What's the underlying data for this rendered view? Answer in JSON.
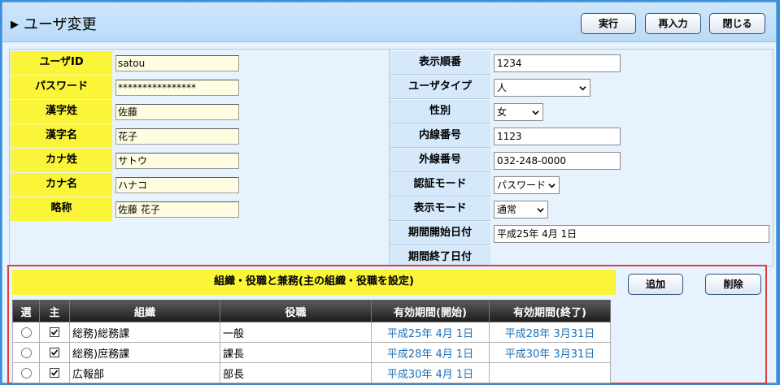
{
  "header": {
    "title": "ユーザ変更",
    "buttons": {
      "execute": "実行",
      "reinput": "再入力",
      "close": "閉じる"
    }
  },
  "left_fields": [
    {
      "label": "ユーザID",
      "value": "satou"
    },
    {
      "label": "パスワード",
      "value": "****************"
    },
    {
      "label": "漢字姓",
      "value": "佐藤"
    },
    {
      "label": "漢字名",
      "value": "花子"
    },
    {
      "label": "カナ姓",
      "value": "サトウ"
    },
    {
      "label": "カナ名",
      "value": "ハナコ"
    },
    {
      "label": "略称",
      "value": "佐藤 花子"
    }
  ],
  "right_fields": {
    "display_order": {
      "label": "表示順番",
      "value": "1234"
    },
    "user_type": {
      "label": "ユーザタイプ",
      "value": "人"
    },
    "gender": {
      "label": "性別",
      "value": "女"
    },
    "ext_number": {
      "label": "内線番号",
      "value": "1123"
    },
    "outside_number": {
      "label": "外線番号",
      "value": "032-248-0000"
    },
    "auth_mode": {
      "label": "認証モード",
      "value": "パスワード"
    },
    "display_mode": {
      "label": "表示モード",
      "value": "通常"
    },
    "period_start": {
      "label": "期間開始日付",
      "value": "平成25年 4月 1日"
    },
    "period_end": {
      "label": "期間終了日付",
      "value": ""
    }
  },
  "org": {
    "title": "組織・役職と兼務(主の組織・役職を設定)",
    "add_label": "追加",
    "delete_label": "削除",
    "columns": [
      "選",
      "主",
      "組織",
      "役職",
      "有効期間(開始)",
      "有効期間(終了)"
    ],
    "rows": [
      {
        "org": "総務)総務課",
        "position": "一般",
        "start": "平成25年 4月 1日",
        "end": "平成28年 3月31日"
      },
      {
        "org": "総務)庶務課",
        "position": "課長",
        "start": "平成28年 4月 1日",
        "end": "平成30年 3月31日"
      },
      {
        "org": "広報部",
        "position": "部長",
        "start": "平成30年 4月 1日",
        "end": ""
      }
    ]
  },
  "colors": {
    "label_yellow": "#fbf53a",
    "frame_blue": "#3a8fd8",
    "highlight_red": "#e23d3d",
    "date_blue": "#1c6fb8"
  }
}
